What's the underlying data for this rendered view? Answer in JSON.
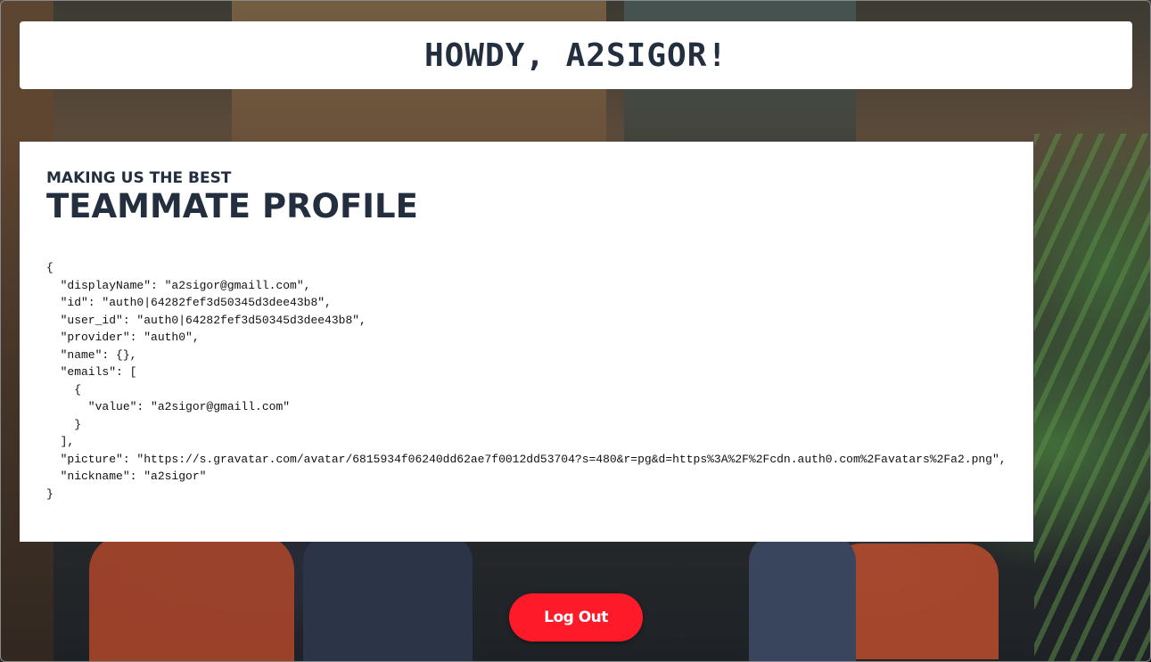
{
  "header": {
    "greeting": "HOWDY, A2SIGOR!"
  },
  "profile_card": {
    "subtitle": "MAKING US THE BEST",
    "title": "TEAMMATE PROFILE",
    "json_text": "{\n  \"displayName\": \"a2sigor@gmaill.com\",\n  \"id\": \"auth0|64282fef3d50345d3dee43b8\",\n  \"user_id\": \"auth0|64282fef3d50345d3dee43b8\",\n  \"provider\": \"auth0\",\n  \"name\": {},\n  \"emails\": [\n    {\n      \"value\": \"a2sigor@gmaill.com\"\n    }\n  ],\n  \"picture\": \"https://s.gravatar.com/avatar/6815934f06240dd62ae7f0012dd53704?s=480&r=pg&d=https%3A%2F%2Fcdn.auth0.com%2Favatars%2Fa2.png\",\n  \"nickname\": \"a2sigor\"\n}"
  },
  "actions": {
    "logout_label": "Log Out"
  },
  "colors": {
    "heading_text": "#232f3e",
    "logout_button": "#ff1a2a"
  }
}
